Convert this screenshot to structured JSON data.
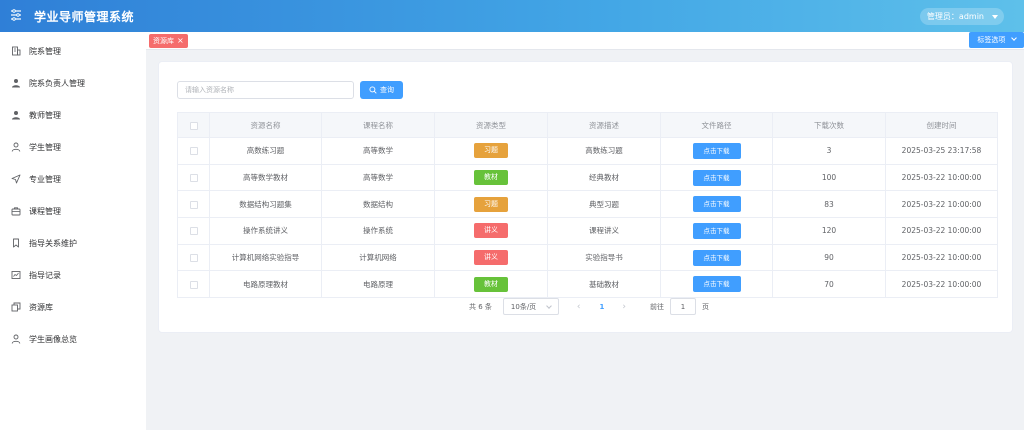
{
  "app": {
    "title": "学业导师管理系统",
    "user_label": "管理员：admin"
  },
  "sidebar": {
    "items": [
      {
        "label": "院系管理",
        "icon": "building-icon"
      },
      {
        "label": "院系负责人管理",
        "icon": "user-icon"
      },
      {
        "label": "教师管理",
        "icon": "user-icon"
      },
      {
        "label": "学生管理",
        "icon": "user-outline-icon"
      },
      {
        "label": "专业管理",
        "icon": "send-icon"
      },
      {
        "label": "课程管理",
        "icon": "briefcase-icon"
      },
      {
        "label": "指导关系维护",
        "icon": "bookmark-icon"
      },
      {
        "label": "指导记录",
        "icon": "chart-icon"
      },
      {
        "label": "资源库",
        "icon": "copy-icon"
      },
      {
        "label": "学生画像总览",
        "icon": "user-outline-icon"
      }
    ]
  },
  "tags": {
    "active": "资源库",
    "options_label": "标签选项"
  },
  "search": {
    "placeholder": "请输入资源名称",
    "value": "",
    "button_label": "查询"
  },
  "table": {
    "headers": [
      "资源名称",
      "课程名称",
      "资源类型",
      "资源描述",
      "文件路径",
      "下载次数",
      "创建时间"
    ],
    "download_label": "点击下载",
    "rows": [
      {
        "name": "高数练习题",
        "course": "高等数学",
        "type": "习题",
        "type_color": "#e6a23c",
        "desc": "高数练习题",
        "downloads": "3",
        "created": "2025-03-25 23:17:58"
      },
      {
        "name": "高等数学教材",
        "course": "高等数学",
        "type": "教材",
        "type_color": "#67c23a",
        "desc": "经典教材",
        "downloads": "100",
        "created": "2025-03-22 10:00:00"
      },
      {
        "name": "数据结构习题集",
        "course": "数据结构",
        "type": "习题",
        "type_color": "#e6a23c",
        "desc": "典型习题",
        "downloads": "83",
        "created": "2025-03-22 10:00:00"
      },
      {
        "name": "操作系统讲义",
        "course": "操作系统",
        "type": "讲义",
        "type_color": "#f56c6c",
        "desc": "课程讲义",
        "downloads": "120",
        "created": "2025-03-22 10:00:00"
      },
      {
        "name": "计算机网络实验指导",
        "course": "计算机网络",
        "type": "讲义",
        "type_color": "#f56c6c",
        "desc": "实验指导书",
        "downloads": "90",
        "created": "2025-03-22 10:00:00"
      },
      {
        "name": "电路原理教材",
        "course": "电路原理",
        "type": "教材",
        "type_color": "#67c23a",
        "desc": "基础教材",
        "downloads": "70",
        "created": "2025-03-22 10:00:00"
      }
    ]
  },
  "pagination": {
    "total_label": "共 6 条",
    "page_size": "10条/页",
    "current_page": "1",
    "goto_label": "前往",
    "goto_value": "1",
    "page_unit": "页"
  }
}
